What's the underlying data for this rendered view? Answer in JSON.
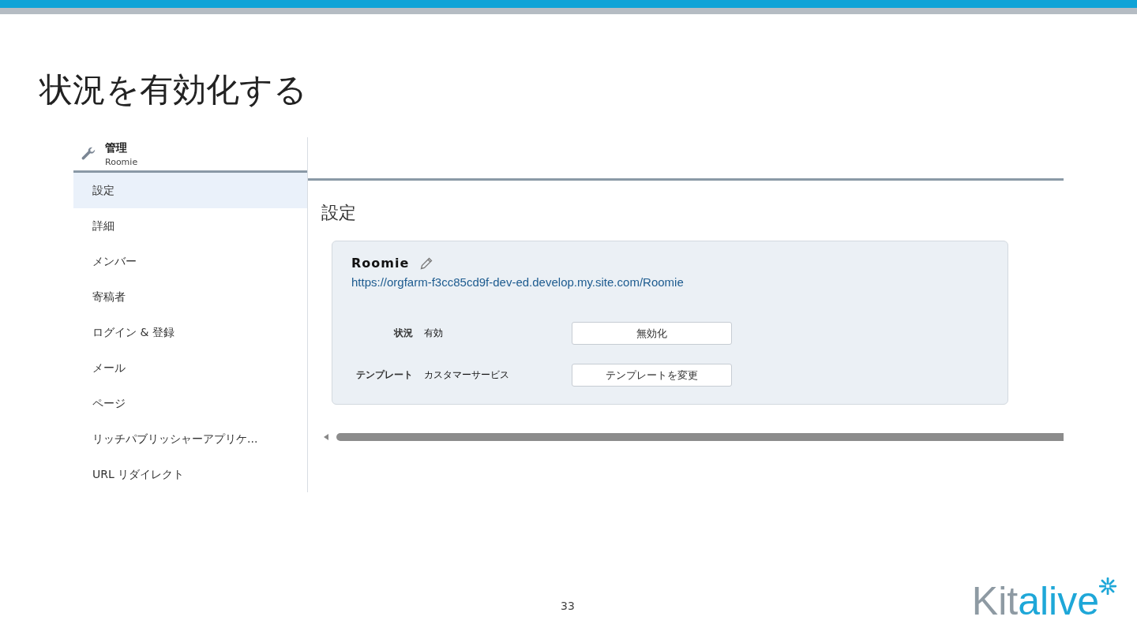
{
  "slide_title": "状況を有効化する",
  "admin_header": {
    "title": "管理",
    "subtitle": "Roomie"
  },
  "sidebar": {
    "items": [
      {
        "label": "設定",
        "selected": true
      },
      {
        "label": "詳細",
        "selected": false
      },
      {
        "label": "メンバー",
        "selected": false
      },
      {
        "label": "寄稿者",
        "selected": false
      },
      {
        "label": "ログイン & 登録",
        "selected": false
      },
      {
        "label": "メール",
        "selected": false
      },
      {
        "label": "ページ",
        "selected": false
      },
      {
        "label": "リッチパブリッシャーアプリケ...",
        "selected": false
      },
      {
        "label": "URL リダイレクト",
        "selected": false
      }
    ]
  },
  "content": {
    "heading": "設定",
    "site": {
      "name": "Roomie",
      "url": "https://orgfarm-f3cc85cd9f-dev-ed.develop.my.site.com/Roomie"
    },
    "fields": [
      {
        "label": "状況",
        "value": "有効",
        "button": "無効化"
      },
      {
        "label": "テンプレート",
        "value": "カスタマーサービス",
        "button": "テンプレートを変更"
      }
    ]
  },
  "page_number": "33",
  "logo": {
    "part_1": "Kit",
    "part_2": "alive"
  }
}
